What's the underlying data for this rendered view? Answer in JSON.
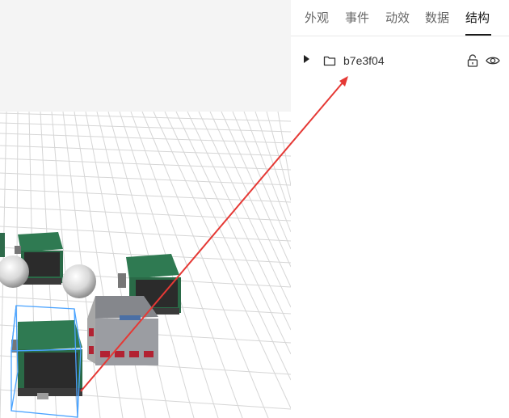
{
  "panel": {
    "tabs": [
      {
        "label": "外观"
      },
      {
        "label": "事件"
      },
      {
        "label": "动效"
      },
      {
        "label": "数据"
      },
      {
        "label": "结构",
        "active": true
      }
    ],
    "tree": {
      "node": {
        "label": "b7e3f04",
        "icon": "folder-icon",
        "locked": false,
        "visible": true
      }
    }
  },
  "viewport": {
    "background": "#f4f4f4",
    "selection_color": "#4aa3ff",
    "pointer_arrow_color": "#e53935"
  }
}
